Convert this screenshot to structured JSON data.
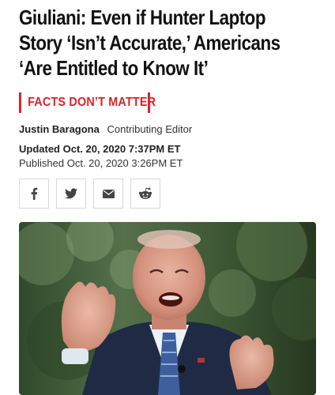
{
  "article": {
    "headline_line1": "Giuliani: Even if Hunter Laptop",
    "headline_line2": "Story ‘Isn’t Accurate,’ Americans",
    "headline_line3": "‘Are Entitled to Know It’",
    "rubric": "FACTS DON’T MATTER",
    "author": "Justin Baragona",
    "author_role": "Contributing Editor",
    "updated": "Updated Oct. 20, 2020 7:37PM ET",
    "published": "Published Oct. 20, 2020 3:26PM ET"
  },
  "share_buttons": [
    {
      "icon": "facebook-icon"
    },
    {
      "icon": "twitter-icon"
    },
    {
      "icon": "email-icon"
    },
    {
      "icon": "reddit-icon"
    }
  ],
  "colors": {
    "accent": "#d8242b",
    "text": "#111111",
    "border": "#d9d9d9"
  }
}
